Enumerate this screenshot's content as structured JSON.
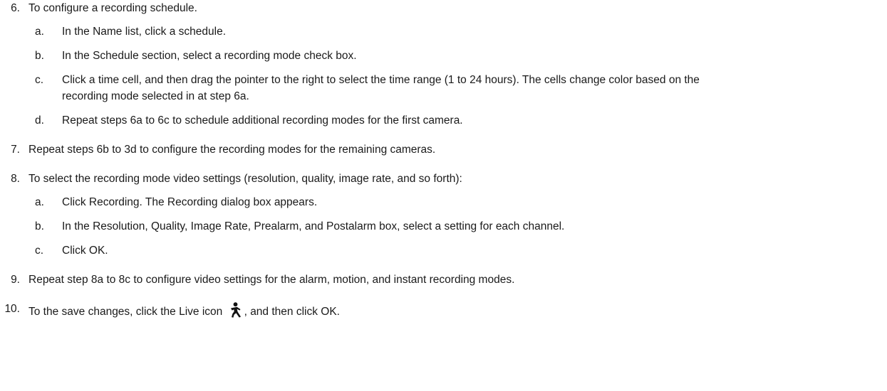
{
  "steps": [
    {
      "num": "6.",
      "text": "To configure a recording schedule."
    },
    {
      "num": "7.",
      "text": "Repeat steps 6b to 3d to configure the recording modes for the remaining cameras."
    },
    {
      "num": "8.",
      "text": "To select the recording mode video settings (resolution, quality, image rate, and so forth):"
    },
    {
      "num": "9.",
      "text": "Repeat step 8a to 8c to configure video settings for the alarm, motion, and instant recording modes."
    },
    {
      "num": "10.",
      "text_before": "To the save changes, click the Live icon",
      "text_after": ", and then click OK."
    }
  ],
  "step6_subs": [
    {
      "letter": "a.",
      "text": "In the Name list, click a schedule."
    },
    {
      "letter": "b.",
      "text": "In the Schedule section, select a recording mode check box."
    },
    {
      "letter": "c.",
      "line1": "Click a time cell, and then drag the pointer to the right to select the time range (1 to 24 hours). The cells change color based on the",
      "line2": "recording mode selected in at step 6a."
    },
    {
      "letter": "d.",
      "text": "Repeat steps 6a to 6c to schedule additional recording modes for the first camera."
    }
  ],
  "step8_subs": [
    {
      "letter": "a.",
      "text": "Click Recording. The Recording dialog box appears."
    },
    {
      "letter": "b.",
      "text": "In the Resolution, Quality, Image Rate, Prealarm, and Postalarm box, select a setting for each channel."
    },
    {
      "letter": "c.",
      "text": "Click OK."
    }
  ],
  "icons": {
    "live": "live-person-icon"
  }
}
